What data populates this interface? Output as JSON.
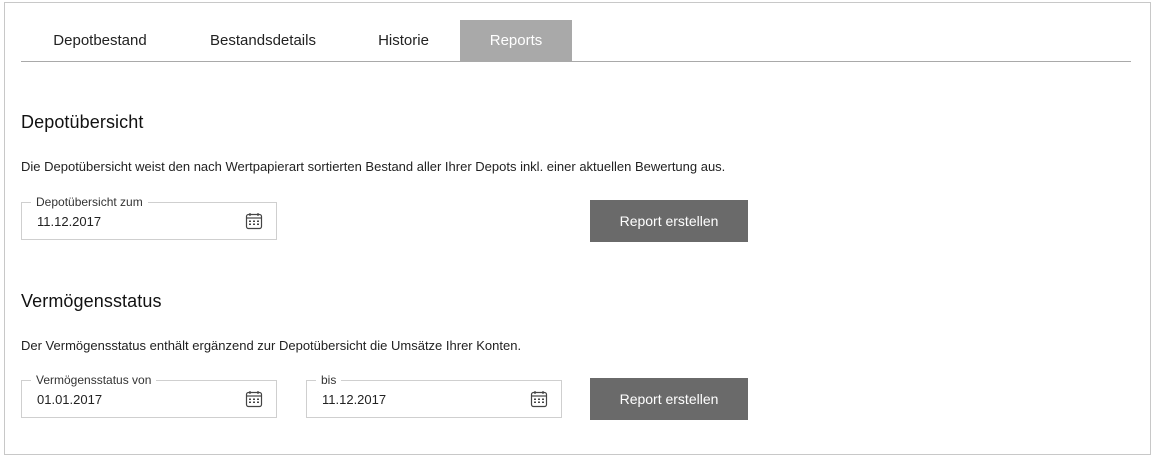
{
  "tabs": [
    {
      "label": "Depotbestand",
      "active": false
    },
    {
      "label": "Bestandsdetails",
      "active": false
    },
    {
      "label": "Historie",
      "active": false
    },
    {
      "label": "Reports",
      "active": true
    }
  ],
  "colors": {
    "active_tab": "#a9a9a9",
    "button": "#6a6a6a"
  },
  "depotuebersicht": {
    "title": "Depotübersicht",
    "description": "Die Depotübersicht weist den nach Wertpapierart sortierten Bestand aller Ihrer Depots inkl. einer aktuellen Bewertung aus.",
    "date_label": "Depotübersicht zum",
    "date_value": "11.12.2017",
    "button_label": "Report erstellen"
  },
  "vermoegensstatus": {
    "title": "Vermögensstatus",
    "description": "Der Vermögensstatus enthält ergänzend zur Depotübersicht die Umsätze Ihrer Konten.",
    "from_label": "Vermögensstatus von",
    "from_value": "01.01.2017",
    "to_label": "bis",
    "to_value": "11.12.2017",
    "button_label": "Report erstellen"
  },
  "icons": {
    "calendar": "calendar-icon"
  }
}
